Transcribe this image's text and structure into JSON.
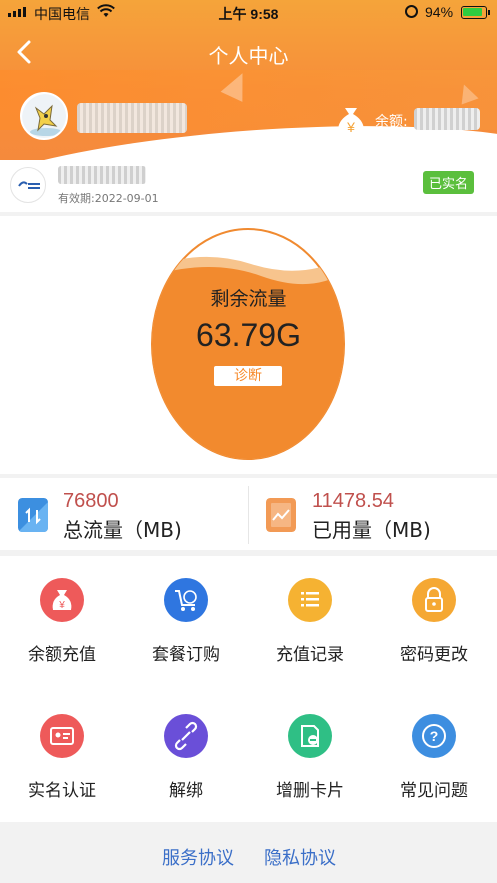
{
  "status_bar": {
    "carrier": "中国电信",
    "time": "上午 9:58",
    "battery": "94%"
  },
  "header": {
    "title": "个人中心",
    "balance_label": "余额:"
  },
  "card": {
    "expiry": "有效期:2022-09-01",
    "verified_badge": "已实名"
  },
  "data_circle": {
    "title": "剩余流量",
    "value": "63.79G",
    "diagnose_label": "诊断"
  },
  "stats": {
    "total_value": "76800",
    "total_label": "总流量（MB)",
    "used_value": "11478.54",
    "used_label": "已用量（MB)"
  },
  "menu": {
    "items": [
      {
        "label": "余额充值",
        "icon": "money-bag-icon",
        "color": "#ee5a5a"
      },
      {
        "label": "套餐订购",
        "icon": "cart-icon",
        "color": "#2f76e0"
      },
      {
        "label": "充值记录",
        "icon": "list-icon",
        "color": "#f5b232"
      },
      {
        "label": "密码更改",
        "icon": "lock-icon",
        "color": "#f5a833"
      },
      {
        "label": "实名认证",
        "icon": "id-card-icon",
        "color": "#ee5a5a"
      },
      {
        "label": "解绑",
        "icon": "unlink-icon",
        "color": "#6a4fd8"
      },
      {
        "label": "增删卡片",
        "icon": "sim-card-icon",
        "color": "#2fbf85"
      },
      {
        "label": "常见问题",
        "icon": "help-icon",
        "color": "#3d8ee0"
      }
    ]
  },
  "footer": {
    "service_agreement": "服务协议",
    "privacy_agreement": "隐私协议"
  },
  "colors": {
    "accent_orange": "#f78d3a",
    "verified_green": "#5bbf3d",
    "link_blue": "#3b6fc8",
    "stat_number": "#c0504d"
  }
}
